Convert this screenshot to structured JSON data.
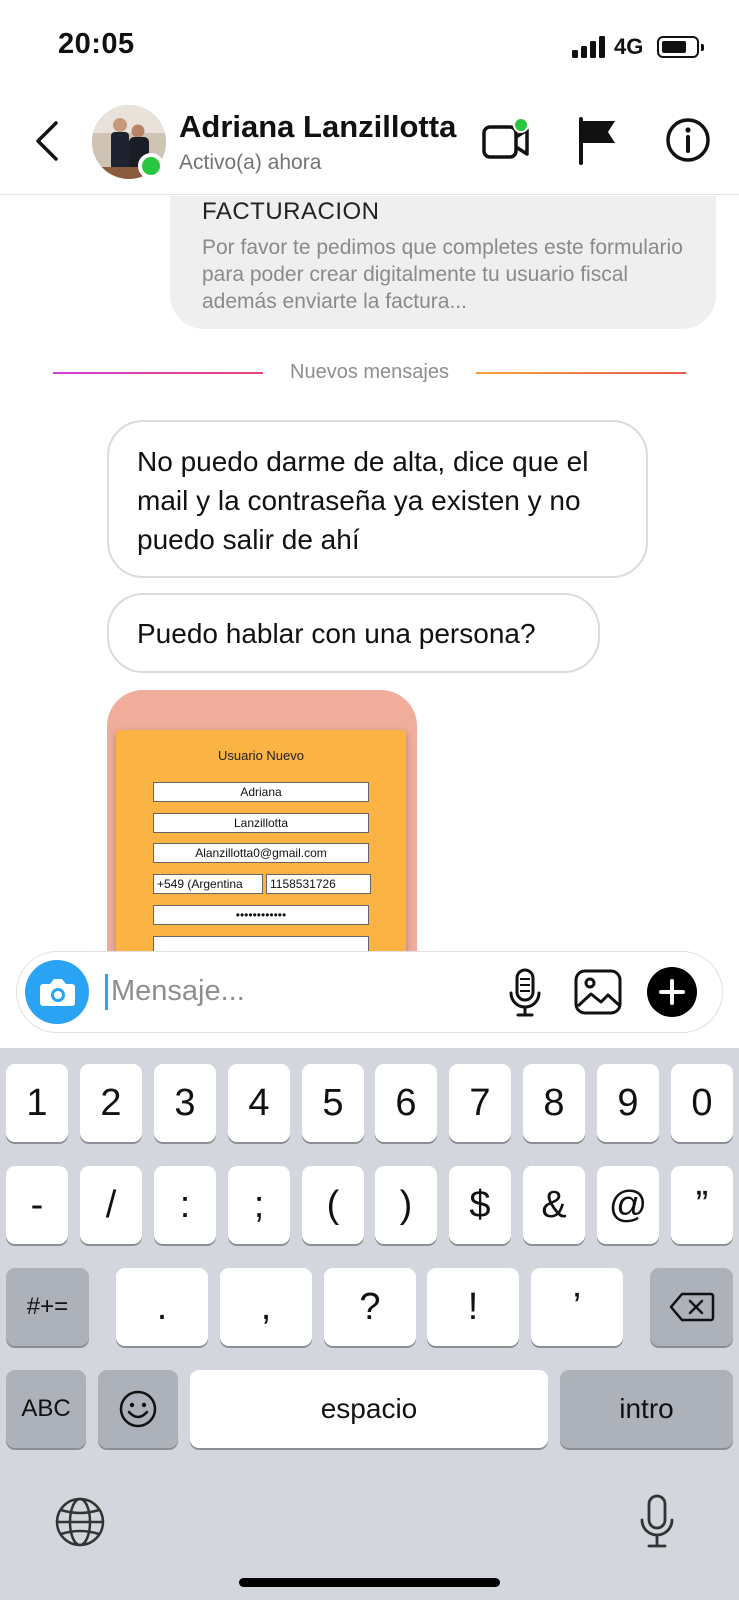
{
  "status_bar": {
    "time": "20:05",
    "network": "4G"
  },
  "header": {
    "contact_name": "Adriana Lanzillotta",
    "contact_status": "Activo(a) ahora",
    "icons": [
      "back-arrow-icon",
      "video-call-icon",
      "flag-icon",
      "info-icon"
    ]
  },
  "chat": {
    "previous_message": {
      "title": "FACTURACION",
      "body": "Por favor te pedimos que completes este formulario para poder crear digitalmente tu usuario fiscal además enviarte la factura..."
    },
    "divider_label": "Nuevos mensajes",
    "messages": [
      {
        "text": "No puedo darme de alta,  dice que el mail y la contraseña ya existen y no puedo salir de ahí"
      },
      {
        "text": "Puedo hablar con una persona?"
      }
    ],
    "image_form": {
      "title": "Usuario Nuevo",
      "first_name": "Adriana",
      "last_name": "Lanzillotta",
      "email": "Alanzillotta0@gmail.com",
      "country_code": "+549 (Argentina",
      "phone": "1158531726",
      "password_mask": "••••••••••••"
    }
  },
  "composer": {
    "placeholder": "Mensaje..."
  },
  "keyboard": {
    "row1": [
      "1",
      "2",
      "3",
      "4",
      "5",
      "6",
      "7",
      "8",
      "9",
      "0"
    ],
    "row2": [
      "-",
      "/",
      ":",
      ";",
      "(",
      ")",
      "$",
      "&",
      "@",
      "”"
    ],
    "row3_symbols": "#+=",
    "row3": [
      ".",
      ",",
      "?",
      "!",
      "’"
    ],
    "abc": "ABC",
    "space": "espacio",
    "return": "intro"
  },
  "colors": {
    "accent": "#2aa3f4",
    "online": "#29c63f",
    "keyboard_bg": "#d3d6dc",
    "form_bg": "#fbb443"
  }
}
